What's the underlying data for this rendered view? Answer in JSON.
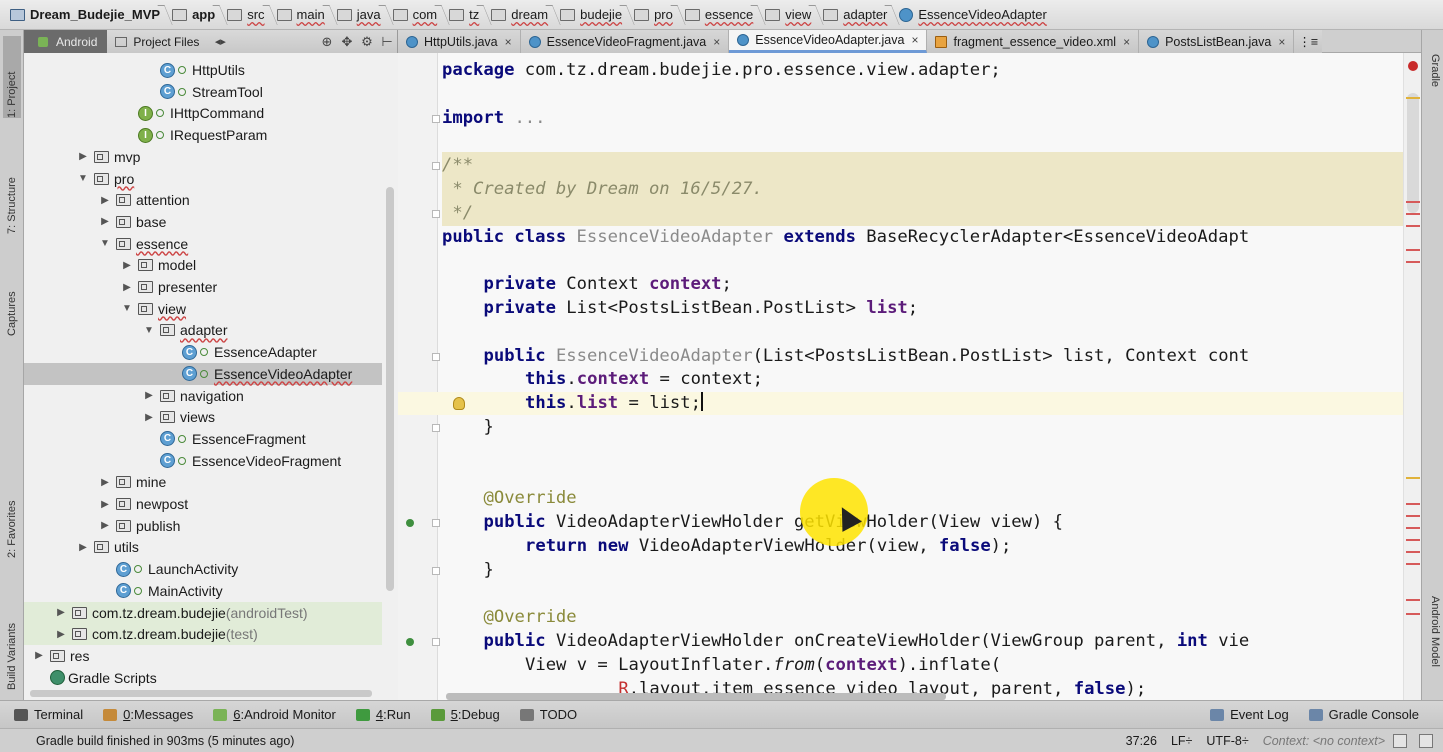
{
  "breadcrumbs": [
    {
      "label": "Dream_Budejie_MVP",
      "kind": "app",
      "plain": true
    },
    {
      "label": "app",
      "kind": "folder",
      "plain": true
    },
    {
      "label": "src",
      "kind": "folder",
      "plain": false
    },
    {
      "label": "main",
      "kind": "folder",
      "plain": false
    },
    {
      "label": "java",
      "kind": "folder",
      "plain": false
    },
    {
      "label": "com",
      "kind": "folder",
      "plain": false
    },
    {
      "label": "tz",
      "kind": "folder",
      "plain": false
    },
    {
      "label": "dream",
      "kind": "folder",
      "plain": false
    },
    {
      "label": "budejie",
      "kind": "folder",
      "plain": false
    },
    {
      "label": "pro",
      "kind": "folder",
      "plain": false
    },
    {
      "label": "essence",
      "kind": "folder",
      "plain": false
    },
    {
      "label": "view",
      "kind": "folder",
      "plain": false
    },
    {
      "label": "adapter",
      "kind": "folder",
      "plain": false
    },
    {
      "label": "EssenceVideoAdapter",
      "kind": "class",
      "plain": false
    }
  ],
  "project_panel": {
    "view_tab": "Android",
    "files_tab": "Project Files",
    "nav_arrows": "◂▸",
    "buttons": [
      "⊕",
      "✥",
      "⚙",
      "⊢"
    ]
  },
  "editor_tabs": [
    {
      "label": "HttpUtils.java",
      "icon": "class-icon",
      "active": false
    },
    {
      "label": "EssenceVideoFragment.java",
      "icon": "class-icon",
      "active": false
    },
    {
      "label": "EssenceVideoAdapter.java",
      "icon": "class-icon",
      "active": true
    },
    {
      "label": "fragment_essence_video.xml",
      "icon": "xml-icon",
      "active": false
    },
    {
      "label": "PostsListBean.java",
      "icon": "class-icon",
      "active": false
    }
  ],
  "tabs_overflow": "⋮≡",
  "tab_close": "×",
  "left_tool_windows": [
    "1: Project",
    "7: Structure",
    "Captures",
    "2: Favorites",
    "Build Variants"
  ],
  "right_tool_windows": [
    "Gradle",
    "Android Model"
  ],
  "tree": [
    {
      "label": "HttpUtils",
      "type": "class",
      "depth": 5,
      "arrow": ""
    },
    {
      "label": "StreamTool",
      "type": "class",
      "depth": 5,
      "arrow": ""
    },
    {
      "label": "IHttpCommand",
      "type": "interface",
      "depth": 4,
      "arrow": ""
    },
    {
      "label": "IRequestParam",
      "type": "interface",
      "depth": 4,
      "arrow": ""
    },
    {
      "label": "mvp",
      "type": "package",
      "depth": 2,
      "arrow": "▶"
    },
    {
      "label": "pro",
      "type": "package",
      "depth": 2,
      "arrow": "▼",
      "underline": true
    },
    {
      "label": "attention",
      "type": "package",
      "depth": 3,
      "arrow": "▶"
    },
    {
      "label": "base",
      "type": "package",
      "depth": 3,
      "arrow": "▶"
    },
    {
      "label": "essence",
      "type": "package",
      "depth": 3,
      "arrow": "▼",
      "underline": true
    },
    {
      "label": "model",
      "type": "package",
      "depth": 4,
      "arrow": "▶"
    },
    {
      "label": "presenter",
      "type": "package",
      "depth": 4,
      "arrow": "▶"
    },
    {
      "label": "view",
      "type": "package",
      "depth": 4,
      "arrow": "▼",
      "underline": true
    },
    {
      "label": "adapter",
      "type": "package",
      "depth": 5,
      "arrow": "▼",
      "underline": true
    },
    {
      "label": "EssenceAdapter",
      "type": "class",
      "depth": 6,
      "arrow": ""
    },
    {
      "label": "EssenceVideoAdapter",
      "type": "class",
      "depth": 6,
      "arrow": "",
      "selected": true,
      "underline": true
    },
    {
      "label": "navigation",
      "type": "package",
      "depth": 5,
      "arrow": "▶"
    },
    {
      "label": "views",
      "type": "package",
      "depth": 5,
      "arrow": "▶"
    },
    {
      "label": "EssenceFragment",
      "type": "class",
      "depth": 5,
      "arrow": ""
    },
    {
      "label": "EssenceVideoFragment",
      "type": "class",
      "depth": 5,
      "arrow": ""
    },
    {
      "label": "mine",
      "type": "package",
      "depth": 3,
      "arrow": "▶"
    },
    {
      "label": "newpost",
      "type": "package",
      "depth": 3,
      "arrow": "▶"
    },
    {
      "label": "publish",
      "type": "package",
      "depth": 3,
      "arrow": "▶"
    },
    {
      "label": "utils",
      "type": "package",
      "depth": 2,
      "arrow": "▶"
    },
    {
      "label": "LaunchActivity",
      "type": "class",
      "depth": 3,
      "arrow": ""
    },
    {
      "label": "MainActivity",
      "type": "class",
      "depth": 3,
      "arrow": ""
    },
    {
      "label": "com.tz.dream.budejie",
      "suffix": " (androidTest)",
      "type": "package",
      "depth": 1,
      "arrow": "▶",
      "green": true
    },
    {
      "label": "com.tz.dream.budejie",
      "suffix": " (test)",
      "type": "package",
      "depth": 1,
      "arrow": "▶",
      "green": true
    },
    {
      "label": "res",
      "type": "res",
      "depth": 0,
      "arrow": "▶"
    },
    {
      "label": "Gradle Scripts",
      "type": "gradle",
      "depth": 0,
      "arrow": ""
    }
  ],
  "code": [
    {
      "row": 0,
      "indent": 0,
      "parts": [
        [
          "k",
          "package"
        ],
        [
          "",
          " com.tz.dream.budejie.pro.essence.view.adapter;"
        ]
      ]
    },
    {
      "row": 2,
      "indent": 0,
      "parts": [
        [
          "k",
          "import"
        ],
        [
          "",
          " "
        ],
        [
          "un",
          "..."
        ]
      ]
    },
    {
      "row": 4,
      "indent": 0,
      "parts": [
        [
          "cm",
          "/**"
        ]
      ]
    },
    {
      "row": 5,
      "indent": 0,
      "parts": [
        [
          "cm",
          " * Created by Dream on 16/5/27."
        ]
      ]
    },
    {
      "row": 6,
      "indent": 0,
      "parts": [
        [
          "cm",
          " */"
        ]
      ]
    },
    {
      "row": 7,
      "indent": 0,
      "parts": [
        [
          "k",
          "public class"
        ],
        [
          "",
          " "
        ],
        [
          "un",
          "EssenceVideoAdapter"
        ],
        [
          "",
          " "
        ],
        [
          "k",
          "extends"
        ],
        [
          "",
          " BaseRecyclerAdapter<EssenceVideoAdapt"
        ]
      ]
    },
    {
      "row": 9,
      "indent": 4,
      "parts": [
        [
          "k",
          "private"
        ],
        [
          "",
          " Context "
        ],
        [
          "fld",
          "context"
        ],
        [
          "",
          ";"
        ]
      ]
    },
    {
      "row": 10,
      "indent": 4,
      "parts": [
        [
          "k",
          "private"
        ],
        [
          "",
          " List<PostsListBean.PostList> "
        ],
        [
          "fld",
          "list"
        ],
        [
          "",
          ";"
        ]
      ]
    },
    {
      "row": 12,
      "indent": 4,
      "parts": [
        [
          "k",
          "public"
        ],
        [
          "",
          " "
        ],
        [
          "un",
          "EssenceVideoAdapter"
        ],
        [
          "",
          "(List<PostsListBean.PostList> list, Context cont"
        ]
      ]
    },
    {
      "row": 13,
      "indent": 8,
      "parts": [
        [
          "k",
          "this"
        ],
        [
          "",
          "."
        ],
        [
          "fld",
          "context"
        ],
        [
          "",
          " = context;"
        ]
      ]
    },
    {
      "row": 14,
      "indent": 8,
      "parts": [
        [
          "k",
          "this"
        ],
        [
          "",
          "."
        ],
        [
          "fld",
          "list"
        ],
        [
          "",
          " = list;"
        ]
      ],
      "caret": true
    },
    {
      "row": 15,
      "indent": 4,
      "parts": [
        [
          "",
          "}"
        ]
      ]
    },
    {
      "row": 18,
      "indent": 4,
      "parts": [
        [
          "an",
          "@Override"
        ]
      ]
    },
    {
      "row": 19,
      "indent": 4,
      "parts": [
        [
          "k",
          "public"
        ],
        [
          "",
          " VideoAdapterViewHolder getViewHolder(View view) {"
        ]
      ]
    },
    {
      "row": 20,
      "indent": 8,
      "parts": [
        [
          "k",
          "return new"
        ],
        [
          "",
          " VideoAdapterViewHolder(view, "
        ],
        [
          "k",
          "false"
        ],
        [
          "",
          ");"
        ]
      ]
    },
    {
      "row": 21,
      "indent": 4,
      "parts": [
        [
          "",
          "}"
        ]
      ]
    },
    {
      "row": 23,
      "indent": 4,
      "parts": [
        [
          "an",
          "@Override"
        ]
      ]
    },
    {
      "row": 24,
      "indent": 4,
      "parts": [
        [
          "k",
          "public"
        ],
        [
          "",
          " VideoAdapterViewHolder onCreateViewHolder(ViewGroup parent, "
        ],
        [
          "k",
          "int"
        ],
        [
          "",
          " vie"
        ]
      ]
    },
    {
      "row": 25,
      "indent": 8,
      "parts": [
        [
          "",
          "View v = LayoutInflater."
        ],
        [
          "it",
          "from"
        ],
        [
          "",
          "("
        ],
        [
          "fld",
          "context"
        ],
        [
          "",
          ").inflate("
        ]
      ]
    },
    {
      "row": 26,
      "indent": 17,
      "parts": [
        [
          "red",
          "R"
        ],
        [
          "",
          ".layout."
        ],
        [
          "",
          "item_essence_video_layout"
        ],
        [
          "",
          ", parent, "
        ],
        [
          "k",
          "false"
        ],
        [
          "",
          ");"
        ]
      ]
    }
  ],
  "bottom_tools": [
    {
      "label": "Terminal",
      "mnemonic": "",
      "icon": "terminal-icon",
      "color": "#555555"
    },
    {
      "label": "Messages",
      "mnemonic": "0",
      "icon": "messages-icon",
      "color": "#c58a3a"
    },
    {
      "label": "Android Monitor",
      "mnemonic": "6",
      "icon": "android-icon",
      "color": "#7ab356"
    },
    {
      "label": "Run",
      "mnemonic": "4",
      "icon": "run-icon",
      "color": "#3f9a3f"
    },
    {
      "label": "Debug",
      "mnemonic": "5",
      "icon": "debug-icon",
      "color": "#5a9a3a"
    },
    {
      "label": "TODO",
      "mnemonic": "",
      "icon": "todo-icon",
      "color": "#777777"
    }
  ],
  "bottom_right_tools": [
    {
      "label": "Event Log",
      "icon": "event-log-icon"
    },
    {
      "label": "Gradle Console",
      "icon": "gradle-console-icon"
    }
  ],
  "status": {
    "message": "Gradle build finished in 903ms (5 minutes ago)",
    "position": "37:26",
    "line_sep": "LF÷",
    "encoding": "UTF-8÷",
    "context": "Context: <no context>"
  }
}
